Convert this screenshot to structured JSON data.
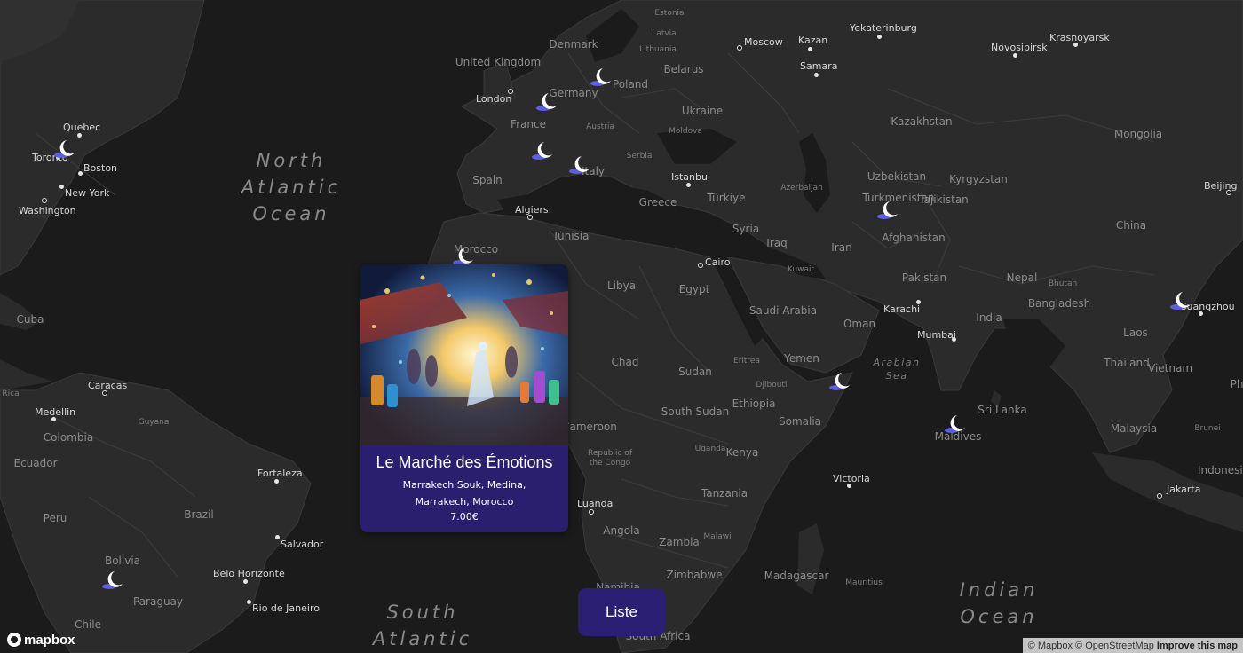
{
  "map": {
    "oceans": [
      {
        "id": "north-atlantic",
        "lines": [
          "North",
          "Atlantic",
          "Ocean"
        ]
      },
      {
        "id": "south-atlantic",
        "lines": [
          "South",
          "Atlantic"
        ]
      },
      {
        "id": "indian",
        "lines": [
          "Indian",
          "Ocean"
        ]
      }
    ],
    "seas": [
      {
        "id": "arabian",
        "lines": [
          "Arabian",
          "Sea"
        ]
      }
    ],
    "countries": [
      "United Kingdom",
      "Denmark",
      "Germany",
      "Poland",
      "France",
      "Belarus",
      "Ukraine",
      "Austria",
      "Moldova",
      "Serbia",
      "Spain",
      "Italy",
      "Greece",
      "Türkiye",
      "Azerbaijan",
      "Turkmenistan",
      "Uzbekistan",
      "Kyrgyzstan",
      "Tajikistan",
      "Kazakhstan",
      "Mongolia",
      "China",
      "Afghanistan",
      "Iran",
      "Iraq",
      "Syria",
      "Kuwait",
      "Saudi Arabia",
      "Oman",
      "Yemen",
      "Eritrea",
      "Djibouti",
      "Ethiopia",
      "Somalia",
      "Pakistan",
      "Nepal",
      "Bhutan",
      "India",
      "Bangladesh",
      "Laos",
      "Thailand",
      "Vietnam",
      "Malaysia",
      "Brunei",
      "Indonesia",
      "Sri Lanka",
      "Maldives",
      "Egypt",
      "Libya",
      "Tunisia",
      "Morocco",
      "Chad",
      "Sudan",
      "South Sudan",
      "Cameroon",
      "Republic of the Congo",
      "Uganda",
      "Kenya",
      "Tanzania",
      "Malawi",
      "Zambia",
      "Angola",
      "Namibia",
      "Zimbabwe",
      "Madagascar",
      "Mauritius",
      "South Africa",
      "Cuba",
      "Rica",
      "Colombia",
      "Ecuador",
      "Guyana",
      "Peru",
      "Brazil",
      "Bolivia",
      "Paraguay",
      "Chile",
      "Estonia",
      "Latvia",
      "Lithuania",
      "Ph"
    ],
    "cities": [
      "Moscow",
      "Kazan",
      "Yekaterinburg",
      "Samara",
      "Novosibirsk",
      "Krasnoyarsk",
      "London",
      "Istanbul",
      "Algiers",
      "Cairo",
      "Karachi",
      "Mumbai",
      "Beijing",
      "Guangzhou",
      "Jakarta",
      "Victoria",
      "Luanda",
      "Toronto",
      "Quebec",
      "Boston",
      "New York",
      "Washington",
      "Caracas",
      "Medellin",
      "Fortaleza",
      "Salvador",
      "Belo Horizonte",
      "Rio de Janeiro"
    ],
    "markers": [
      "dream-marker-toronto",
      "dream-marker-london",
      "dream-marker-germany",
      "dream-marker-france",
      "dream-marker-italy",
      "dream-marker-morocco",
      "dream-marker-turkmenistan",
      "dream-marker-guangzhou",
      "dream-marker-arabian-sea",
      "dream-marker-maldives",
      "dream-marker-bolivia"
    ],
    "marker_icon": "crescent-moon-icon"
  },
  "popup": {
    "title": "Le Marché des Émotions",
    "address": "Marrakech Souk, Medina, Marrakech, Morocco",
    "price": "7.00€"
  },
  "liste_button": {
    "label": "Liste"
  },
  "brand": {
    "logo_text": "mapbox"
  },
  "attribution": {
    "mapbox": "© Mapbox",
    "osm": "© OpenStreetMap",
    "improve": "Improve this map"
  },
  "colors": {
    "land": "#2b2b2b",
    "water": "#1b1b1b",
    "accent": "#2b1f73",
    "moon": "#ffffff",
    "cloud": "#5d5fe0"
  }
}
